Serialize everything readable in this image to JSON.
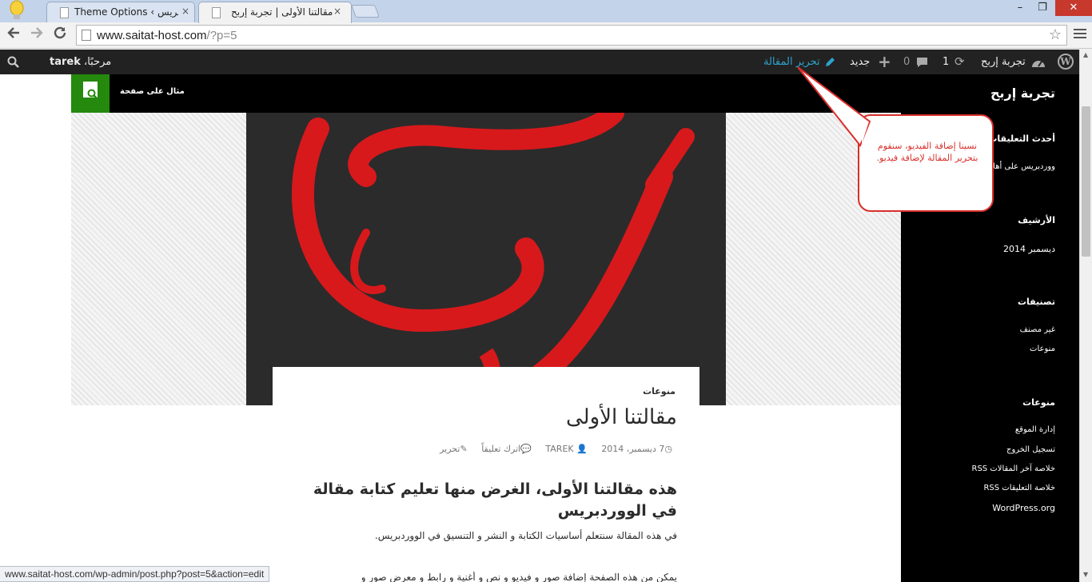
{
  "browser": {
    "tabs": [
      {
        "title": "Theme Options ‹ ووردبريس",
        "active": false
      },
      {
        "title": "مقالتنا الأولى | تجربة إربح",
        "active": true
      }
    ],
    "close_glyph": "×",
    "window_controls": {
      "minimize": "–",
      "restore": "❐",
      "close": "✕"
    },
    "url_host": "www.saitat-host.com",
    "url_rest": "/?p=5"
  },
  "adminbar": {
    "site_name": "تجربة إربح",
    "updates_count": "1",
    "comments_count": "0",
    "new_label": "جديد",
    "edit_label": "تحرير المقالة",
    "greeting": "مرحبًا، ",
    "username": "tarek"
  },
  "site": {
    "title": "تجربة إربح",
    "menu_item": "مثال على صفحة"
  },
  "post": {
    "category": "منوعات",
    "title": "مقالتنا الأولى",
    "date": "7 ديسمبر، 2014",
    "author": "TAREK",
    "comment_link": "اترك تعليقاً",
    "edit_link": "تحرير",
    "subheading": "هذه مقالتنا الأولى، الغرض منها تعليم كتابة مقالة في الووردبريس",
    "paragraph1": "في هذه المقالة سنتعلم أساسيات الكتابة و النشر و التنسيق في الووردبريس.",
    "paragraph2": "يمكن من هذه الصفحة إضافة صور و فيديو و نص و أغنية و رابط و معرض صور و"
  },
  "sidebar": {
    "recent_comments_title": "أحدث التعليقات",
    "recent_comment": "ووردبريس على أهلاً",
    "archives_title": "الأرشيف",
    "archive_item": "ديسمبر 2014",
    "categories_title": "تصنيفات",
    "categories": [
      "غير مصنف",
      "منوعات"
    ],
    "meta_title": "منوعات",
    "meta_links": [
      "إدارة الموقع",
      "تسجيل الخروج",
      "خلاصة آخر المقالات RSS",
      "خلاصة التعليقات RSS",
      "WordPress.org"
    ]
  },
  "callout": {
    "text": "نسينا إضافة الفيديو، سنقوم بتحرير المقالة لإضافة فيديو."
  },
  "status": {
    "url": "www.saitat-host.com/wp-admin/post.php?post=5&action=edit"
  },
  "colors": {
    "accent_green": "#24890d",
    "edit_link_blue": "#2ea2cc",
    "callout_red": "#d9302c",
    "logo_red": "#d7191c"
  }
}
